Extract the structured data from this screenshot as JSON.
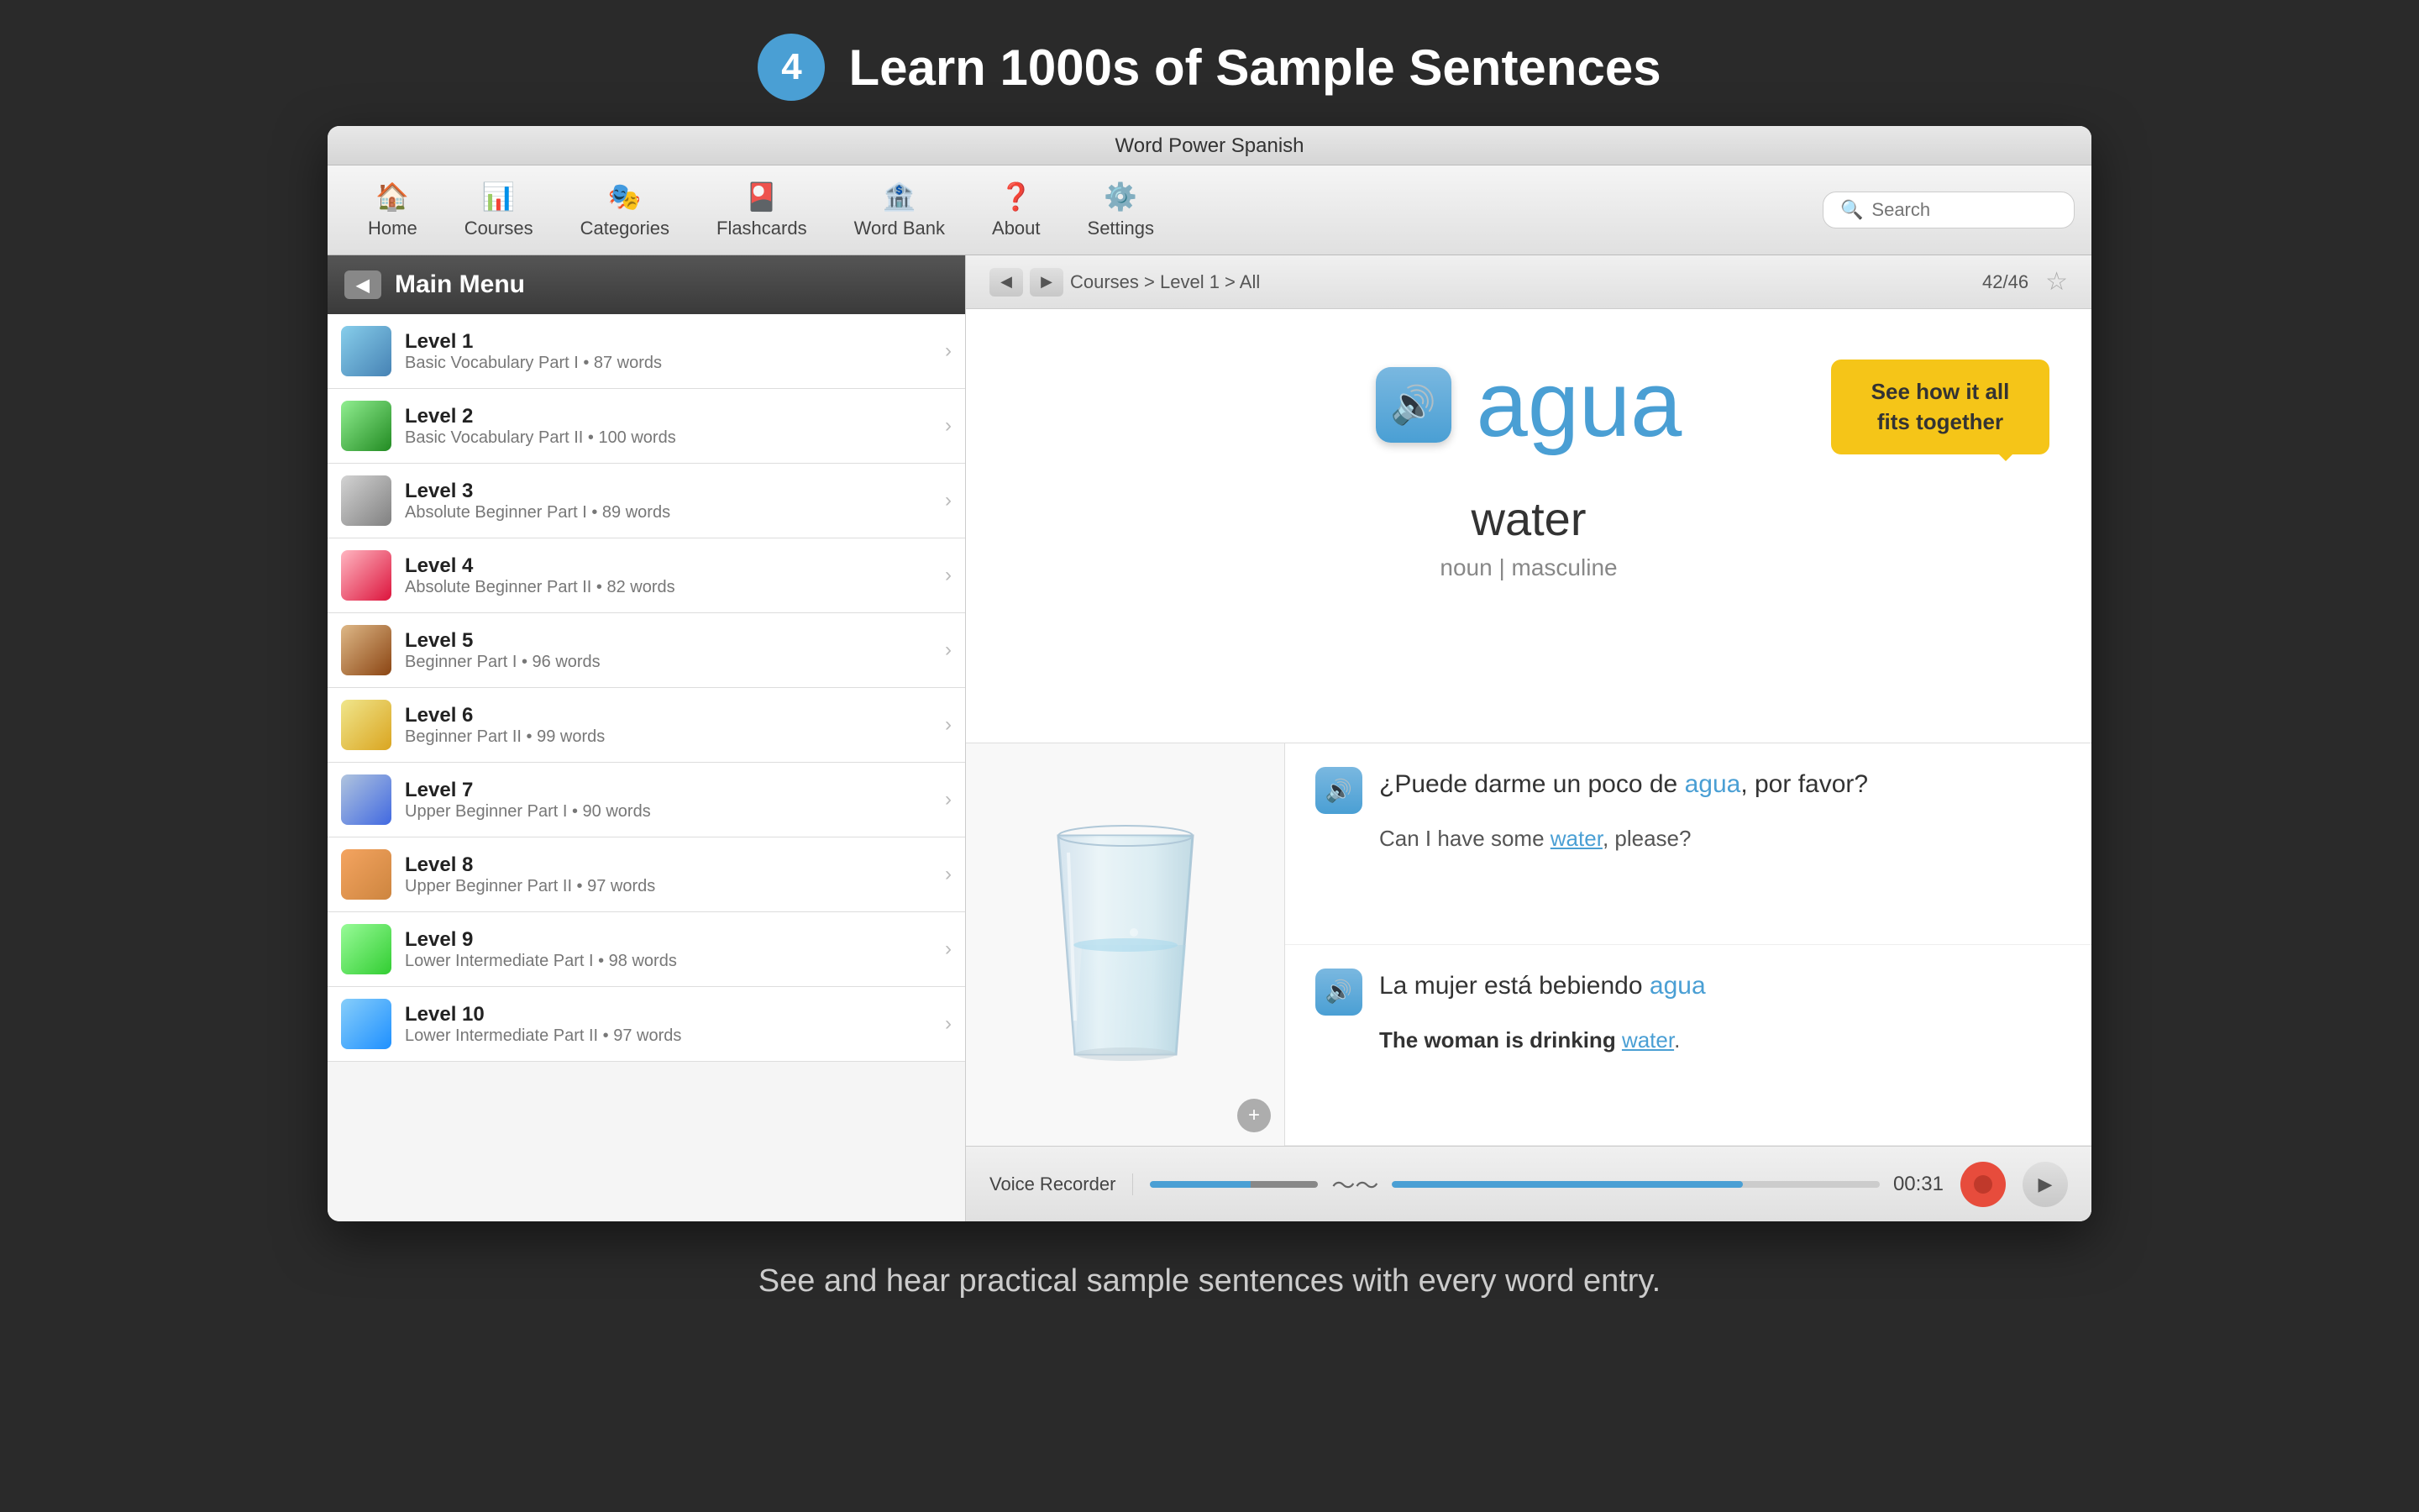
{
  "page": {
    "step_number": "4",
    "title": "Learn 1000s of Sample Sentences",
    "caption": "See and hear practical sample sentences with every word entry."
  },
  "app": {
    "title": "Word Power Spanish",
    "search_placeholder": "Search"
  },
  "nav": {
    "items": [
      {
        "id": "home",
        "label": "Home",
        "icon": "🏠"
      },
      {
        "id": "courses",
        "label": "Courses",
        "icon": "📊"
      },
      {
        "id": "categories",
        "label": "Categories",
        "icon": "🎭"
      },
      {
        "id": "flashcards",
        "label": "Flashcards",
        "icon": "🎴"
      },
      {
        "id": "wordbank",
        "label": "Word Bank",
        "icon": "🏦"
      },
      {
        "id": "about",
        "label": "About",
        "icon": "❓"
      },
      {
        "id": "settings",
        "label": "Settings",
        "icon": "⚙️"
      }
    ]
  },
  "sidebar": {
    "title": "Main Menu",
    "levels": [
      {
        "id": 1,
        "name": "Level 1",
        "desc": "Basic Vocabulary Part I • 87 words",
        "thumb_class": "thumb-1"
      },
      {
        "id": 2,
        "name": "Level 2",
        "desc": "Basic Vocabulary Part II • 100 words",
        "thumb_class": "thumb-2"
      },
      {
        "id": 3,
        "name": "Level 3",
        "desc": "Absolute Beginner Part I • 89 words",
        "thumb_class": "thumb-3"
      },
      {
        "id": 4,
        "name": "Level 4",
        "desc": "Absolute Beginner Part II • 82 words",
        "thumb_class": "thumb-4"
      },
      {
        "id": 5,
        "name": "Level 5",
        "desc": "Beginner Part I • 96 words",
        "thumb_class": "thumb-5"
      },
      {
        "id": 6,
        "name": "Level 6",
        "desc": "Beginner Part II • 99 words",
        "thumb_class": "thumb-6"
      },
      {
        "id": 7,
        "name": "Level 7",
        "desc": "Upper Beginner Part I • 90 words",
        "thumb_class": "thumb-7"
      },
      {
        "id": 8,
        "name": "Level 8",
        "desc": "Upper Beginner Part II • 97 words",
        "thumb_class": "thumb-8"
      },
      {
        "id": 9,
        "name": "Level 9",
        "desc": "Lower Intermediate Part I • 98 words",
        "thumb_class": "thumb-9"
      },
      {
        "id": 10,
        "name": "Level 10",
        "desc": "Lower Intermediate Part II • 97 words",
        "thumb_class": "thumb-10"
      }
    ]
  },
  "breadcrumb": "Courses > Level 1 > All",
  "page_count": "42/46",
  "word": {
    "spanish": "agua",
    "english": "water",
    "part_of_speech": "noun | masculine"
  },
  "tooltip": {
    "text": "See how it all fits together"
  },
  "sentences": [
    {
      "spanish": "¿Puede darme un poco de agua, por favor?",
      "spanish_highlight": "agua",
      "english": "Can I have some water, please?",
      "english_highlight": "water"
    },
    {
      "spanish": "La mujer está bebiendo agua",
      "spanish_highlight": "agua",
      "english": "The woman is drinking water.",
      "english_highlight": "water"
    }
  ],
  "voice_recorder": {
    "label": "Voice Recorder",
    "progress_percent": 72,
    "time": "00:31"
  }
}
